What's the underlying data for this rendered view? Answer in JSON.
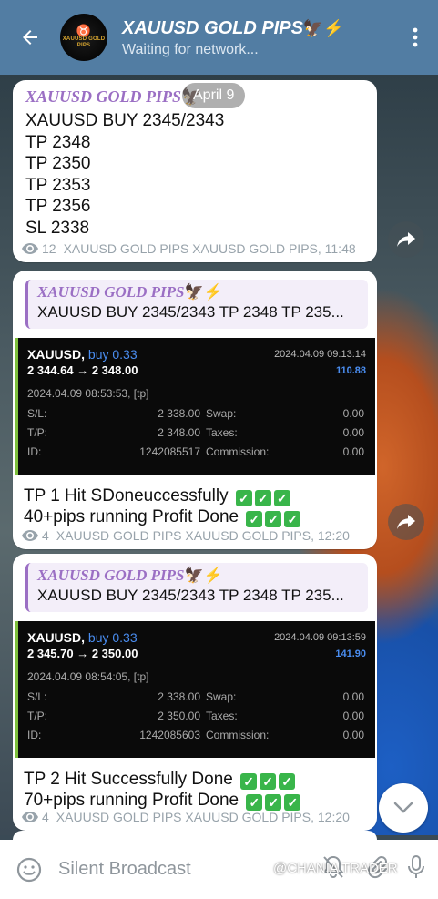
{
  "header": {
    "channel_name": "XAUUSD GOLD PIPS",
    "title_emoji": "🦅⚡",
    "status": "Waiting for network...",
    "avatar_text": "XAUUSD GOLD PIPS"
  },
  "date_pill": "April 9",
  "messages": [
    {
      "sender": "XAUUSD GOLD PIPS",
      "sender_emoji": "🦅",
      "lines": [
        "XAUUSD BUY 2345/2343",
        "TP 2348",
        "TP 2350",
        "TP 2353",
        "TP 2356",
        "SL 2338"
      ],
      "views": "12",
      "signature": "XAUUSD GOLD PIPS XAUUSD GOLD PIPS, 11:48"
    },
    {
      "reply_sender": "XAUUSD GOLD PIPS",
      "reply_emoji": "🦅⚡",
      "reply_text": "XAUUSD BUY 2345/2343 TP 2348 TP 235...",
      "trade": {
        "symbol": "XAUUSD,",
        "direction": "buy 0.33",
        "prices": "2 344.64 → 2 348.00",
        "timestamp": "2024.04.09 09:13:14",
        "profit": "110.88",
        "opened": "2024.04.09 08:53:53, [tp]",
        "sl_label": "S/L:",
        "sl": "2 338.00",
        "swap_label": "Swap:",
        "swap": "0.00",
        "tp_label": "T/P:",
        "tp": "2 348.00",
        "taxes_label": "Taxes:",
        "taxes": "0.00",
        "id_label": "ID:",
        "id": "1242085517",
        "commission_label": "Commission:",
        "commission": "0.00"
      },
      "line1": "TP 1 Hit SDoneuccessfully",
      "line2": "40+pips running Profit Done",
      "views": "4",
      "signature": "XAUUSD GOLD PIPS XAUUSD GOLD PIPS, 12:20"
    },
    {
      "reply_sender": "XAUUSD GOLD PIPS",
      "reply_emoji": "🦅⚡",
      "reply_text": "XAUUSD BUY 2345/2343 TP 2348 TP 235...",
      "trade": {
        "symbol": "XAUUSD,",
        "direction": "buy 0.33",
        "prices": "2 345.70 → 2 350.00",
        "timestamp": "2024.04.09 09:13:59",
        "profit": "141.90",
        "opened": "2024.04.09 08:54:05, [tp]",
        "sl_label": "S/L:",
        "sl": "2 338.00",
        "swap_label": "Swap:",
        "swap": "0.00",
        "tp_label": "T/P:",
        "tp": "2 350.00",
        "taxes_label": "Taxes:",
        "taxes": "0.00",
        "id_label": "ID:",
        "id": "1242085603",
        "commission_label": "Commission:",
        "commission": "0.00"
      },
      "line1": "TP 2 Hit Successfully Done",
      "line2": "70+pips running Profit Done",
      "views": "4",
      "signature": "XAUUSD GOLD PIPS XAUUSD GOLD PIPS, 12:20"
    }
  ],
  "check_mark": "✓",
  "footer": {
    "placeholder": "Silent Broadcast",
    "watermark": "@CHANIA TRADER"
  },
  "colors": {
    "header_bg": "#527da3",
    "sender": "#9b6fc4",
    "accent_blue": "#4a8df0",
    "check_green": "#39b54a"
  },
  "icons": [
    "back-arrow-icon",
    "more-vert-icon",
    "eye-icon",
    "share-icon",
    "chevron-down-icon",
    "emoji-icon",
    "mute-bell-icon",
    "attach-icon",
    "mic-icon"
  ]
}
